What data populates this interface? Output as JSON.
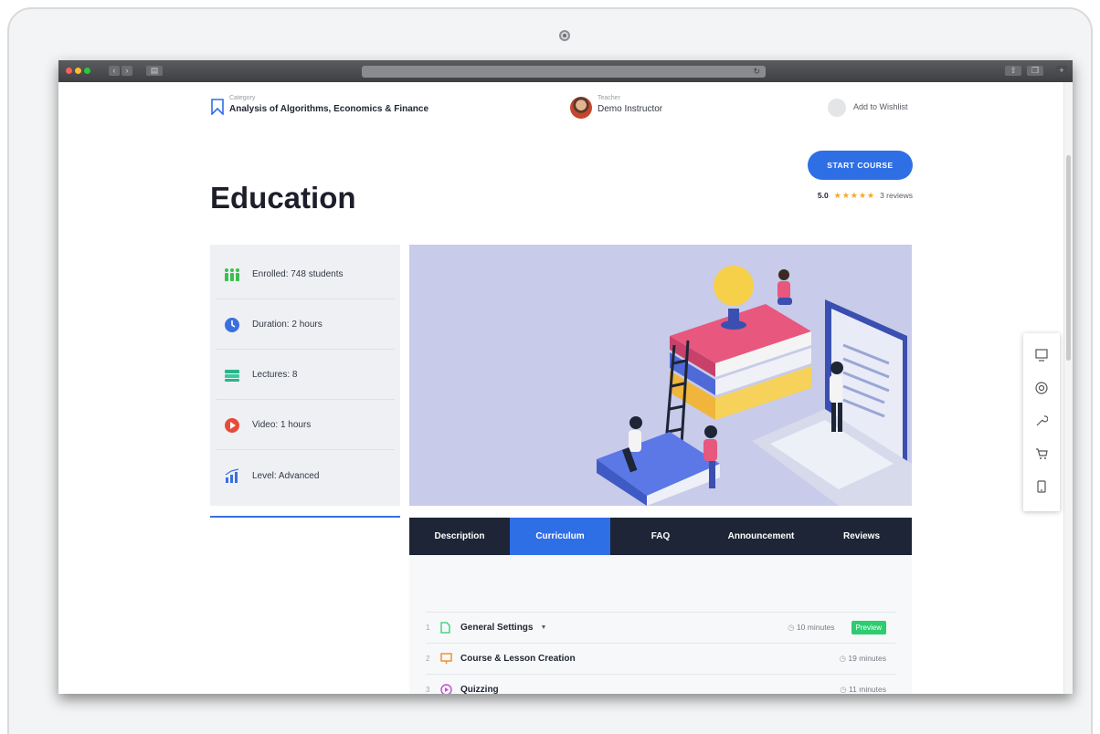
{
  "course": {
    "category_label": "Category",
    "category": "Analysis of Algorithms, Economics & Finance",
    "teacher_label": "Teacher",
    "teacher": "Demo Instructor",
    "wishlist": "Add to Wishlist",
    "title": "Education",
    "start_button": "START COURSE",
    "rating_score": "5.0",
    "rating_stars": "★★★★★",
    "rating_reviews": "3 reviews"
  },
  "info": [
    {
      "label": "Enrolled: 748 students",
      "icon": "students-icon"
    },
    {
      "label": "Duration: 2 hours",
      "icon": "clock-icon"
    },
    {
      "label": "Lectures: 8",
      "icon": "book-stack-icon"
    },
    {
      "label": "Video: 1 hours",
      "icon": "play-icon"
    },
    {
      "label": "Level: Advanced",
      "icon": "bar-chart-icon"
    }
  ],
  "tabs": [
    "Description",
    "Curriculum",
    "FAQ",
    "Announcement",
    "Reviews"
  ],
  "active_tab": "Curriculum",
  "lessons": [
    {
      "num": "1",
      "title": "General Settings",
      "duration": "10 minutes",
      "preview": "Preview",
      "icon": "document-icon"
    },
    {
      "num": "2",
      "title": "Course & Lesson Creation",
      "duration": "19 minutes",
      "icon": "presentation-icon"
    },
    {
      "num": "3",
      "title": "Quizzing",
      "duration": "11 minutes",
      "icon": "video-icon"
    }
  ],
  "colors": {
    "accent": "#2f6fe6",
    "dark_nav": "#1e2536",
    "preview": "#2ecc71",
    "star": "#f4a623"
  }
}
